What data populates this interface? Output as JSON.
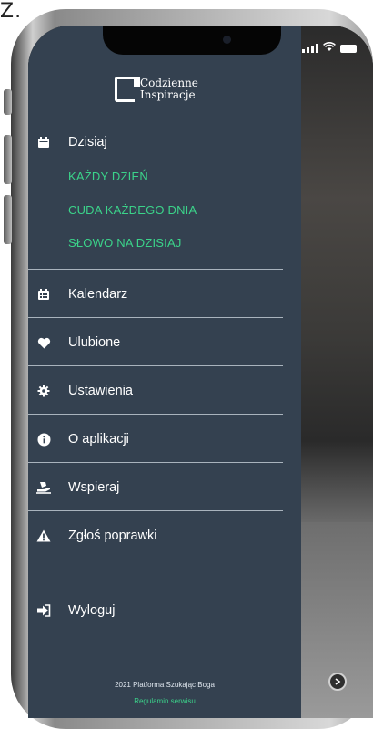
{
  "corner_text": "Z.",
  "logo": {
    "line1": "Codzienne",
    "line2": "Inspiracje"
  },
  "menu": {
    "today": {
      "label": "Dzisiaj",
      "icon": "calendar-day-icon"
    },
    "subitems": [
      "KAŻDY DZIEŃ",
      "CUDA KAŻDEGO DNIA",
      "SŁOWO NA DZISIAJ"
    ],
    "items": [
      {
        "label": "Kalendarz",
        "icon": "calendar-icon"
      },
      {
        "label": "Ulubione",
        "icon": "heart-icon"
      },
      {
        "label": "Ustawienia",
        "icon": "gear-icon"
      },
      {
        "label": "O aplikacji",
        "icon": "info-icon"
      },
      {
        "label": "Wspieraj",
        "icon": "donate-icon"
      },
      {
        "label": "Zgłoś poprawki",
        "icon": "warning-icon"
      }
    ],
    "logout": {
      "label": "Wyloguj",
      "icon": "logout-icon"
    }
  },
  "footer": {
    "copyright": "2021 Platforma Szukając Boga",
    "link": "Regulamin serwisu"
  },
  "colors": {
    "drawer_bg": "#344150",
    "accent": "#3bd38a",
    "text": "#ffffff",
    "divider": "#a9b3bd"
  }
}
